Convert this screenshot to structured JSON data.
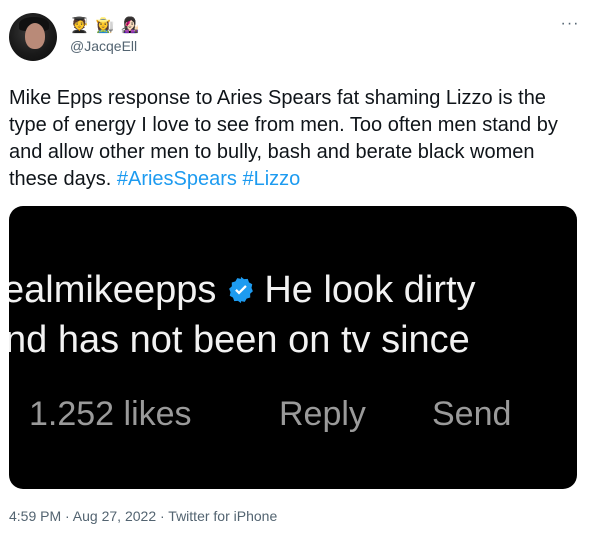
{
  "author": {
    "display_name": "🧑‍🎓 👩‍🌾 👩🏻‍🎤",
    "handle": "@JacqeEll"
  },
  "more_label": "···",
  "tweet": {
    "text": "Mike Epps response to Aries Spears fat shaming Lizzo is the type of energy I love to see from men. Too often men stand by and allow other men to bully, bash and berate black women these days.",
    "hashtags": [
      "#AriesSpears",
      "#Lizzo"
    ]
  },
  "media": {
    "username": "ealmikeepps",
    "comment_line1": "He look dirty",
    "comment_line2": "nd has not been on tv since",
    "likes": "1.252 likes",
    "reply": "Reply",
    "send": "Send"
  },
  "footer": {
    "timestamp": "4:59 PM · Aug 27, 2022 · Twitter for iPhone"
  },
  "colors": {
    "hashtag": "#1d9bf0",
    "verified": "#1d9bf0",
    "muted": "#536471"
  }
}
